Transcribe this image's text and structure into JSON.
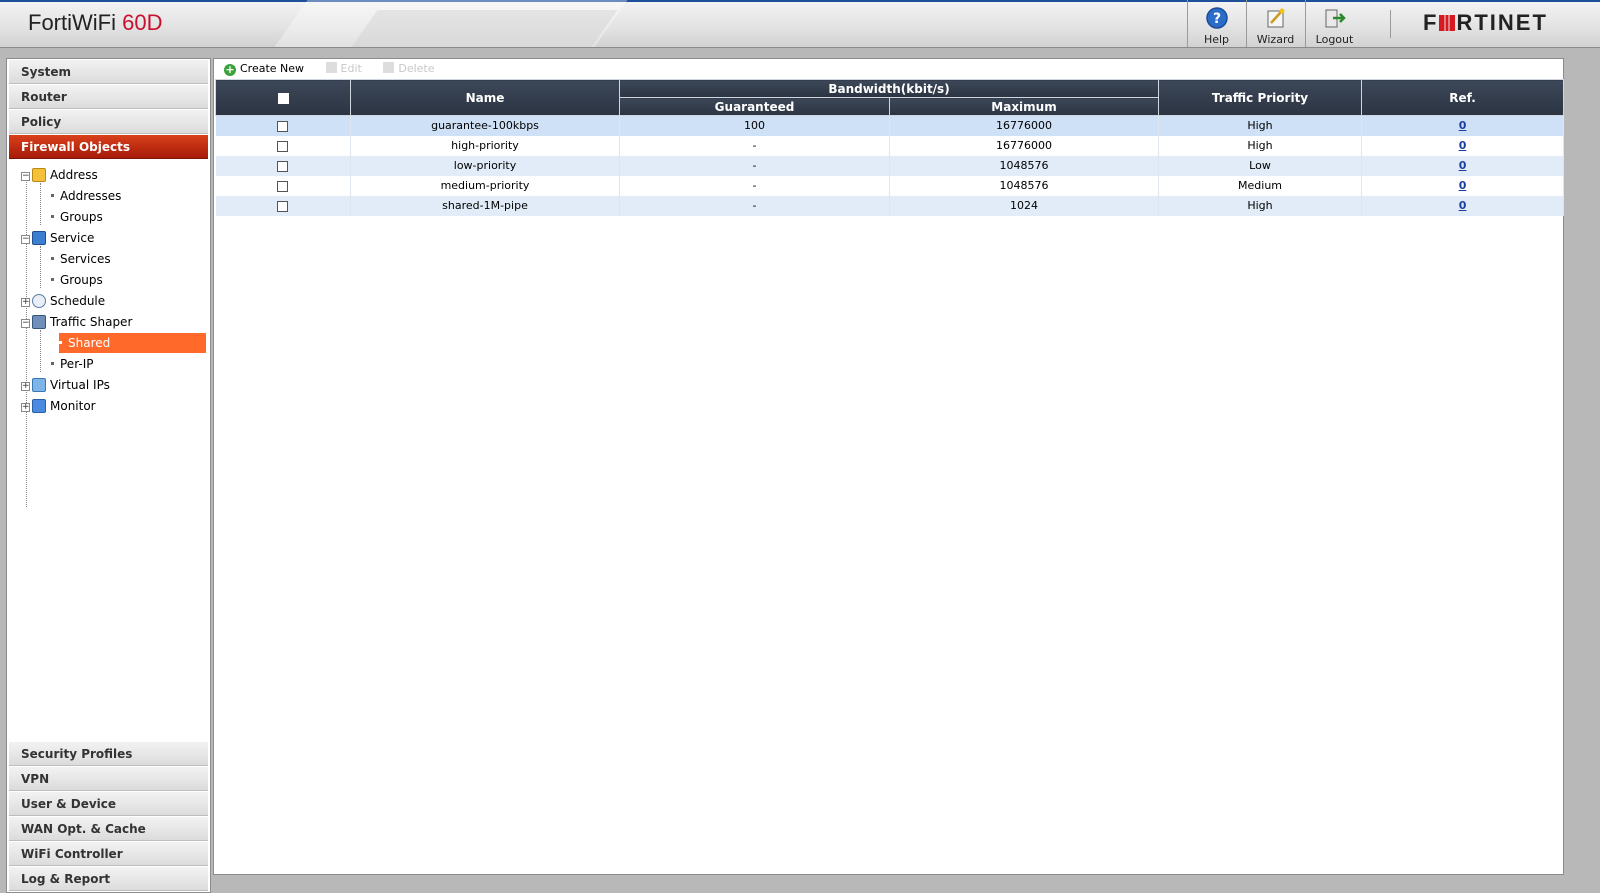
{
  "header": {
    "product_name": "FortiWiFi",
    "product_model": "60D",
    "buttons": [
      {
        "label": "Help",
        "icon": "help-icon"
      },
      {
        "label": "Wizard",
        "icon": "wizard-icon"
      },
      {
        "label": "Logout",
        "icon": "logout-icon"
      }
    ],
    "brand_pre": "F",
    "brand_post": "RTINET",
    "accent_color": "#1e4f9a",
    "brand_color": "#d71920"
  },
  "sidebar": {
    "top_sections": [
      "System",
      "Router",
      "Policy",
      "Firewall Objects"
    ],
    "active_section": "Firewall Objects",
    "tree": {
      "address": "Address",
      "addresses": "Addresses",
      "address_groups": "Groups",
      "service": "Service",
      "services": "Services",
      "service_groups": "Groups",
      "schedule": "Schedule",
      "traffic_shaper": "Traffic Shaper",
      "shared": "Shared",
      "per_ip": "Per-IP",
      "virtual_ips": "Virtual IPs",
      "monitor": "Monitor"
    },
    "bottom_sections": [
      "Security Profiles",
      "VPN",
      "User & Device",
      "WAN Opt. & Cache",
      "WiFi Controller",
      "Log & Report"
    ]
  },
  "toolbar": {
    "create_new": "Create New",
    "edit": "Edit",
    "delete": "Delete"
  },
  "table": {
    "headers": {
      "name": "Name",
      "bandwidth": "Bandwidth(kbit/s)",
      "guaranteed": "Guaranteed",
      "maximum": "Maximum",
      "priority": "Traffic Priority",
      "ref": "Ref."
    },
    "rows": [
      {
        "name": "guarantee-100kbps",
        "guaranteed": "100",
        "maximum": "16776000",
        "priority": "High",
        "ref": "0"
      },
      {
        "name": "high-priority",
        "guaranteed": "-",
        "maximum": "16776000",
        "priority": "High",
        "ref": "0"
      },
      {
        "name": "low-priority",
        "guaranteed": "-",
        "maximum": "1048576",
        "priority": "Low",
        "ref": "0"
      },
      {
        "name": "medium-priority",
        "guaranteed": "-",
        "maximum": "1048576",
        "priority": "Medium",
        "ref": "0"
      },
      {
        "name": "shared-1M-pipe",
        "guaranteed": "-",
        "maximum": "1024",
        "priority": "High",
        "ref": "0"
      }
    ]
  }
}
